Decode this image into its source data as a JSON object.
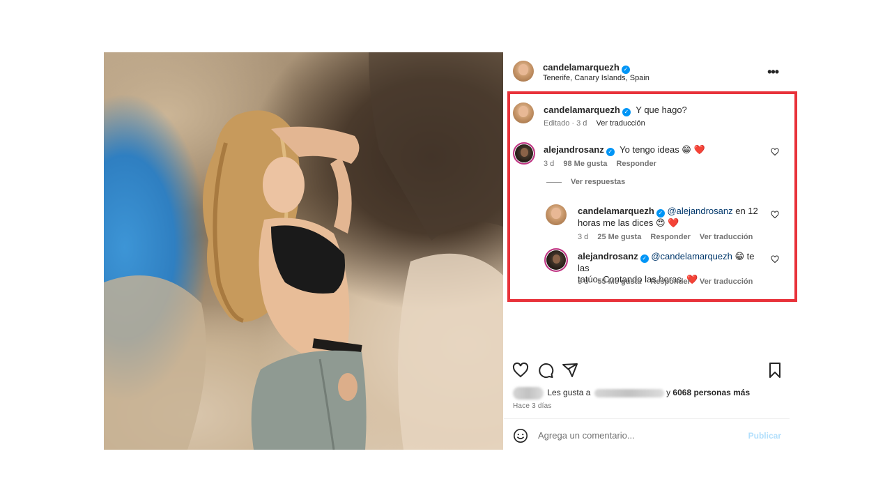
{
  "post": {
    "author": "candelamarquezh",
    "location": "Tenerife, Canary Islands, Spain",
    "more_icon": "more-horizontal-icon"
  },
  "comments": [
    {
      "user": "candelamarquezh",
      "text": "Y que hago?",
      "edited": "Editado",
      "time": "3 d",
      "translate": "Ver traducción"
    },
    {
      "user": "alejandrosanz",
      "text": "Yo tengo ideas 😁 ❤️",
      "time": "3 d",
      "likes": "98 Me gusta",
      "reply": "Responder",
      "view_replies": "Ver respuestas"
    }
  ],
  "replies": [
    {
      "user": "candelamarquezh",
      "mention": "@alejandrosanz",
      "text_a": " en 12",
      "text_b": "horas me las dices 😍 ❤️",
      "time": "3 d",
      "likes": "25 Me gusta",
      "reply": "Responder",
      "translate": "Ver traducción"
    },
    {
      "user": "alejandrosanz",
      "mention": "@candelamarquezh",
      "text_a": " 😁 te las",
      "text_b": "tatúo. Contando las horas. ❤️",
      "time": "3 d",
      "likes": "55 Me gusta",
      "reply": "Responder",
      "translate": "Ver traducción"
    }
  ],
  "likes_summary": {
    "prefix": "Les gusta a",
    "connector": "y",
    "count": "6068 personas más"
  },
  "ago": "Hace 3 días",
  "add_comment": {
    "placeholder": "Agrega un comentario...",
    "publish": "Publicar"
  },
  "colors": {
    "highlight_border": "#e8323a",
    "verified": "#0095f6",
    "publish_disabled": "#b2dffc"
  }
}
